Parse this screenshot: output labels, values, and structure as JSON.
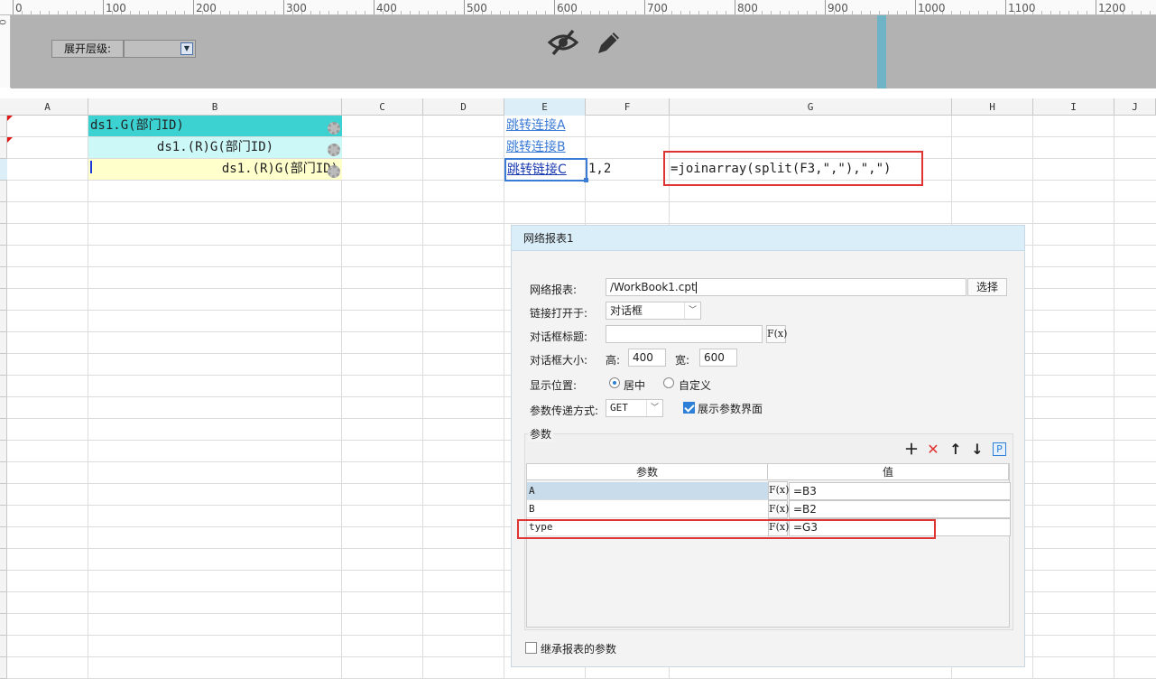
{
  "ruler": {
    "labels": [
      "0",
      "100",
      "200",
      "300",
      "400",
      "500",
      "600",
      "700",
      "800",
      "900",
      "1000",
      "1100",
      "1200"
    ],
    "vlabel": "0"
  },
  "parameter_panel": {
    "expand_level_label": "展开层级:"
  },
  "icons": {
    "eye": "eye-slash-icon",
    "pencil": "pencil-icon",
    "gear": "gear-icon"
  },
  "columns": [
    "A",
    "B",
    "C",
    "D",
    "E",
    "F",
    "G",
    "H",
    "I",
    "J"
  ],
  "cells": {
    "b1": "ds1.G(部门ID)",
    "b2": "ds1.(R)G(部门ID)",
    "b3": "ds1.(R)G(部门ID)",
    "e1": "跳转连接A",
    "e2": "跳转连接B",
    "e3": "跳转链接C",
    "f3": "1,2",
    "g3": "=joinarray(split(F3,\",\"),\",\")"
  },
  "colors": {
    "teal": "#3dd2d2",
    "light_cyan": "#cdf8f8",
    "light_yellow": "#ffffcc",
    "red_highlight": "#e03434",
    "accent_blue": "#2d7fd8"
  },
  "dialog": {
    "title": "网络报表1",
    "report_label": "网络报表:",
    "report_value": "/WorkBook1.cpt",
    "choose_button": "选择",
    "open_in_label": "链接打开于:",
    "open_in_value": "对话框",
    "dialog_title_label": "对话框标题:",
    "dialog_title_value": "",
    "fx_label": "F(x)",
    "size_label": "对话框大小:",
    "height_label": "高:",
    "height_value": "400",
    "width_label": "宽:",
    "width_value": "600",
    "position_label": "显示位置:",
    "position_center": "居中",
    "position_custom": "自定义",
    "position_selected": "居中",
    "param_method_label": "参数传递方式:",
    "param_method_value": "GET",
    "show_param_ui_label": "展示参数界面",
    "show_param_ui_checked": true,
    "params_group_label": "参数",
    "table_headers": [
      "参数",
      "值"
    ],
    "params": [
      {
        "name": "A",
        "value": "=B3"
      },
      {
        "name": "B",
        "value": "=B2"
      },
      {
        "name": "type",
        "value": "=G3"
      }
    ],
    "inherit_label": "继承报表的参数",
    "inherit_checked": false
  }
}
